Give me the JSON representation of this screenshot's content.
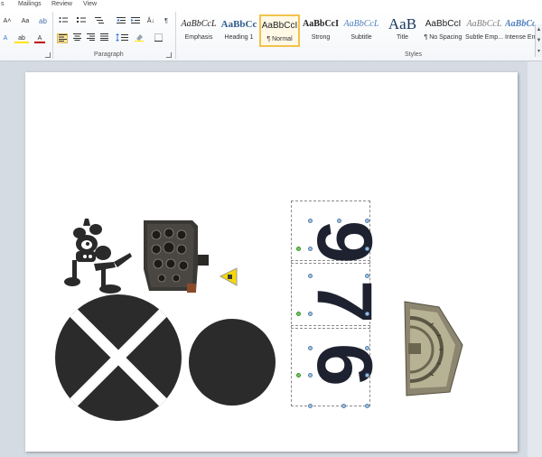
{
  "tabs": [
    "s",
    "Mailings",
    "Review",
    "View"
  ],
  "font_group": {
    "grow_font": "A˄",
    "change_case": "Aa",
    "text_effects": "A",
    "highlight": "ab",
    "font_color": "A"
  },
  "paragraph": {
    "label": "Paragraph",
    "sort": "Å↓",
    "pilcrow": "¶"
  },
  "styles_group": {
    "label": "Styles",
    "items": [
      {
        "sample": "AaBbCcL",
        "label": "Emphasis"
      },
      {
        "sample": "AaBbCc",
        "label": "Heading 1"
      },
      {
        "sample": "AaBbCcI",
        "label": "¶ Normal"
      },
      {
        "sample": "AaBbCcI",
        "label": "Strong"
      },
      {
        "sample": "AaBbCcL",
        "label": "Subtitle"
      },
      {
        "sample": "AaB",
        "label": "Title"
      },
      {
        "sample": "AaBbCcI",
        "label": "¶ No Spacing"
      },
      {
        "sample": "AaBbCcL",
        "label": "Subtle Emp..."
      },
      {
        "sample": "AaBbCcL",
        "label": "Intense Em..."
      }
    ]
  },
  "document": {
    "numbers_text": [
      "9",
      "7",
      "6"
    ],
    "colors": {
      "dark_shape": "#2b2b2b",
      "numbers": "#1e2230",
      "warning": "#f5d90a",
      "selection_handle": "#9dc3e6",
      "rotate_handle": "#6fcf5b"
    }
  }
}
